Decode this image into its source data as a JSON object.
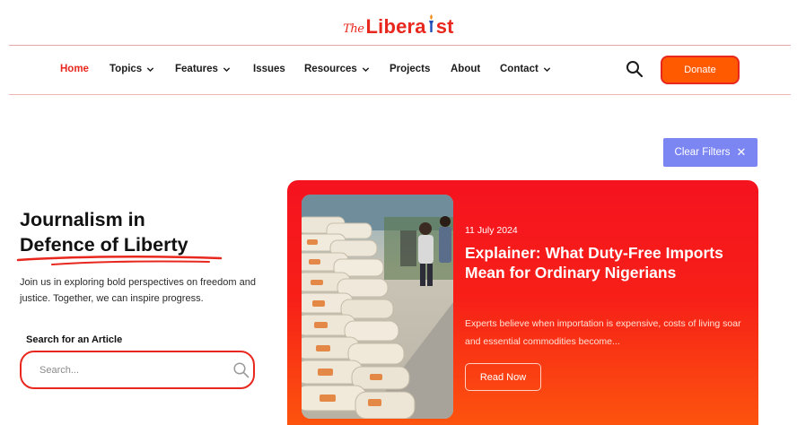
{
  "brand": {
    "prefix": "The",
    "name_before": "Libera",
    "name_after": "st",
    "accent_color": "#e8281e",
    "donate_color": "#ff5a00",
    "filter_color": "#7c86f2"
  },
  "nav": {
    "items": [
      {
        "label": "Home",
        "active": true,
        "has_dropdown": false
      },
      {
        "label": "Topics",
        "active": false,
        "has_dropdown": true
      },
      {
        "label": "Features",
        "active": false,
        "has_dropdown": true
      },
      {
        "label": "Issues",
        "active": false,
        "has_dropdown": false
      },
      {
        "label": "Resources",
        "active": false,
        "has_dropdown": true
      },
      {
        "label": "Projects",
        "active": false,
        "has_dropdown": false
      },
      {
        "label": "About",
        "active": false,
        "has_dropdown": false
      },
      {
        "label": "Contact",
        "active": false,
        "has_dropdown": true
      }
    ],
    "search_icon": "search-icon",
    "donate_label": "Donate"
  },
  "filters": {
    "clear_label": "Clear Filters",
    "clear_icon": "close-icon"
  },
  "hero": {
    "title_line1": "Journalism in",
    "title_line2": "Defence of Liberty",
    "description": "Join us in exploring bold perspectives on freedom and justice. Together, we can inspire progress.",
    "search_label": "Search for an Article",
    "search_placeholder": "Search...",
    "search_icon": "search-icon"
  },
  "featured": {
    "date": "11 July 2024",
    "title": "Explainer: What Duty-Free Imports  Mean for Ordinary Nigerians",
    "excerpt": "Experts believe when importation is expensive, costs of living soar and essential commodities become...",
    "button_label": "Read Now",
    "image_alt": "stacked rice sacks in a market"
  }
}
